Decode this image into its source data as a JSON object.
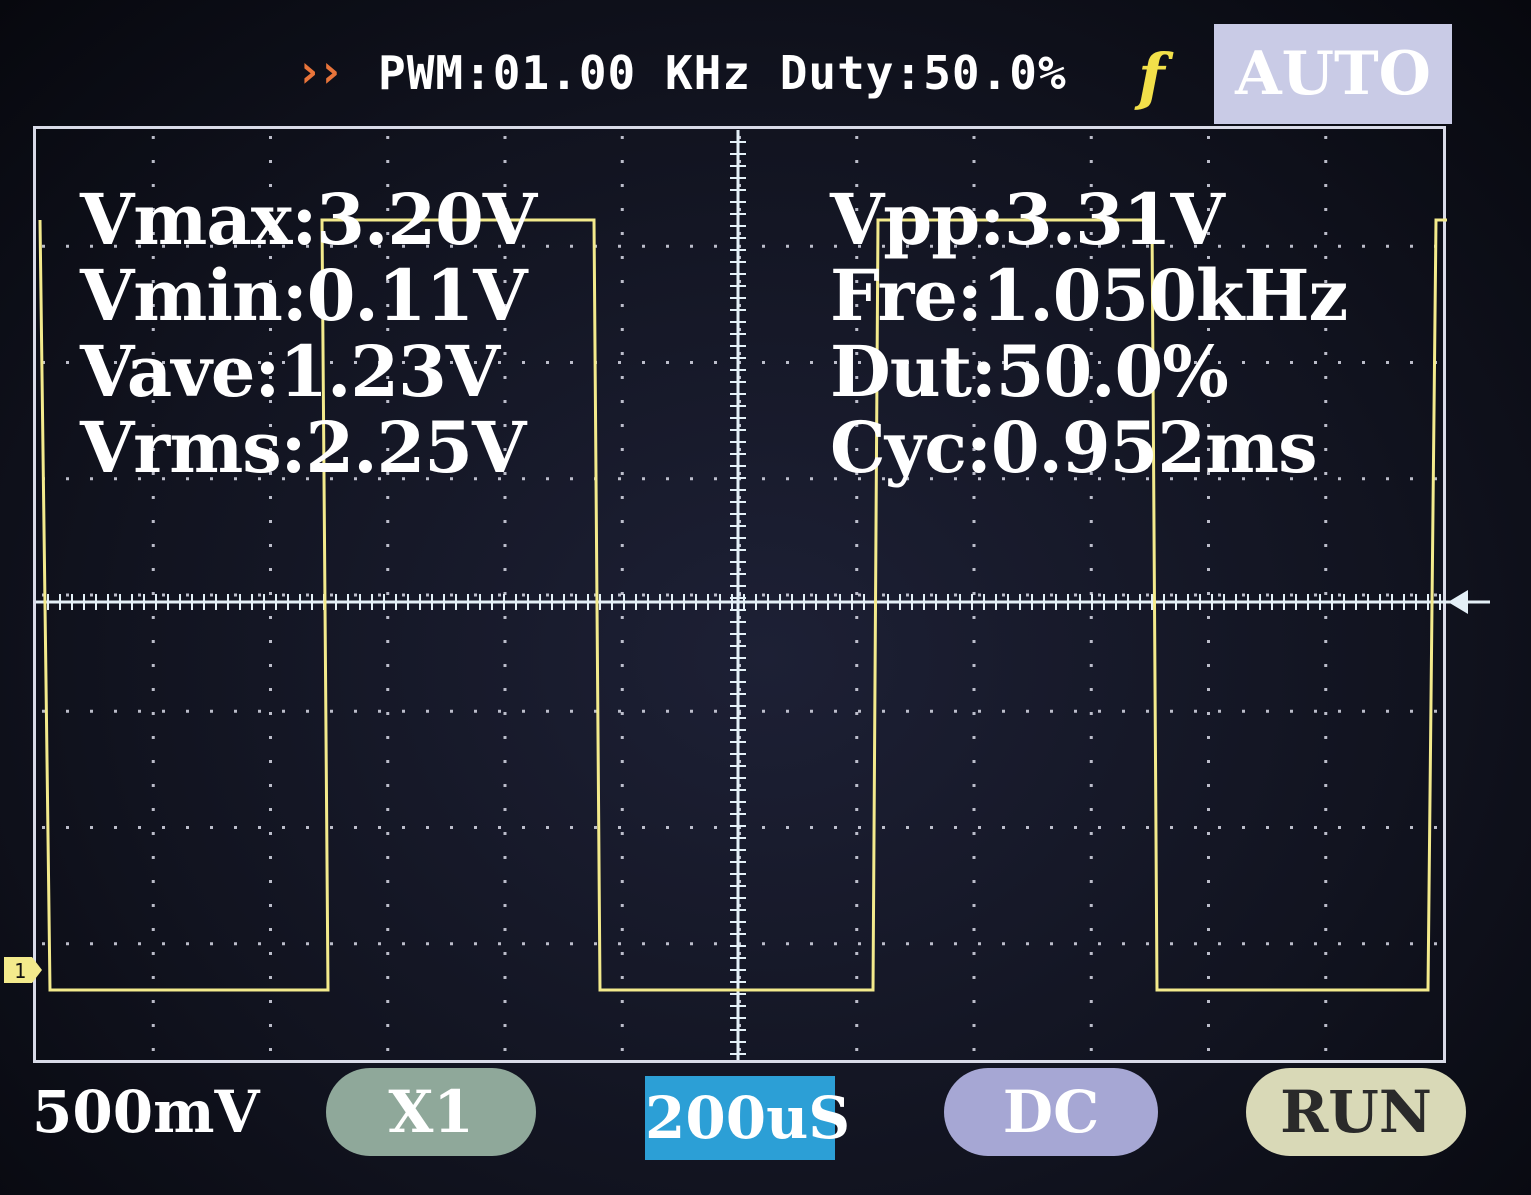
{
  "header": {
    "pwm_label": "PWM:01.00 KHz Duty:50.0%",
    "chevrons": "››",
    "trigger_symbol": "f",
    "mode": "AUTO"
  },
  "measurements": {
    "left": [
      "Vmax:3.20V",
      "Vmin:0.11V",
      "Vave:1.23V",
      "Vrms:2.25V"
    ],
    "right": [
      "Vpp:3.31V",
      "Fre:1.050kHz",
      "Dut:50.0%",
      "Cyc:0.952ms"
    ]
  },
  "channel": {
    "marker": "1",
    "color": "#f3ea8c"
  },
  "footer": {
    "volts_div": "500mV",
    "probe": "X1",
    "time_div": "200uS",
    "coupling": "DC",
    "state": "RUN"
  },
  "colors": {
    "trace": "#f3ea8c",
    "grid": "#d9dbe8",
    "chevron": "#e8743a",
    "trigger": "#f2e04a",
    "time_div_bg": "#2c9fd6"
  }
}
